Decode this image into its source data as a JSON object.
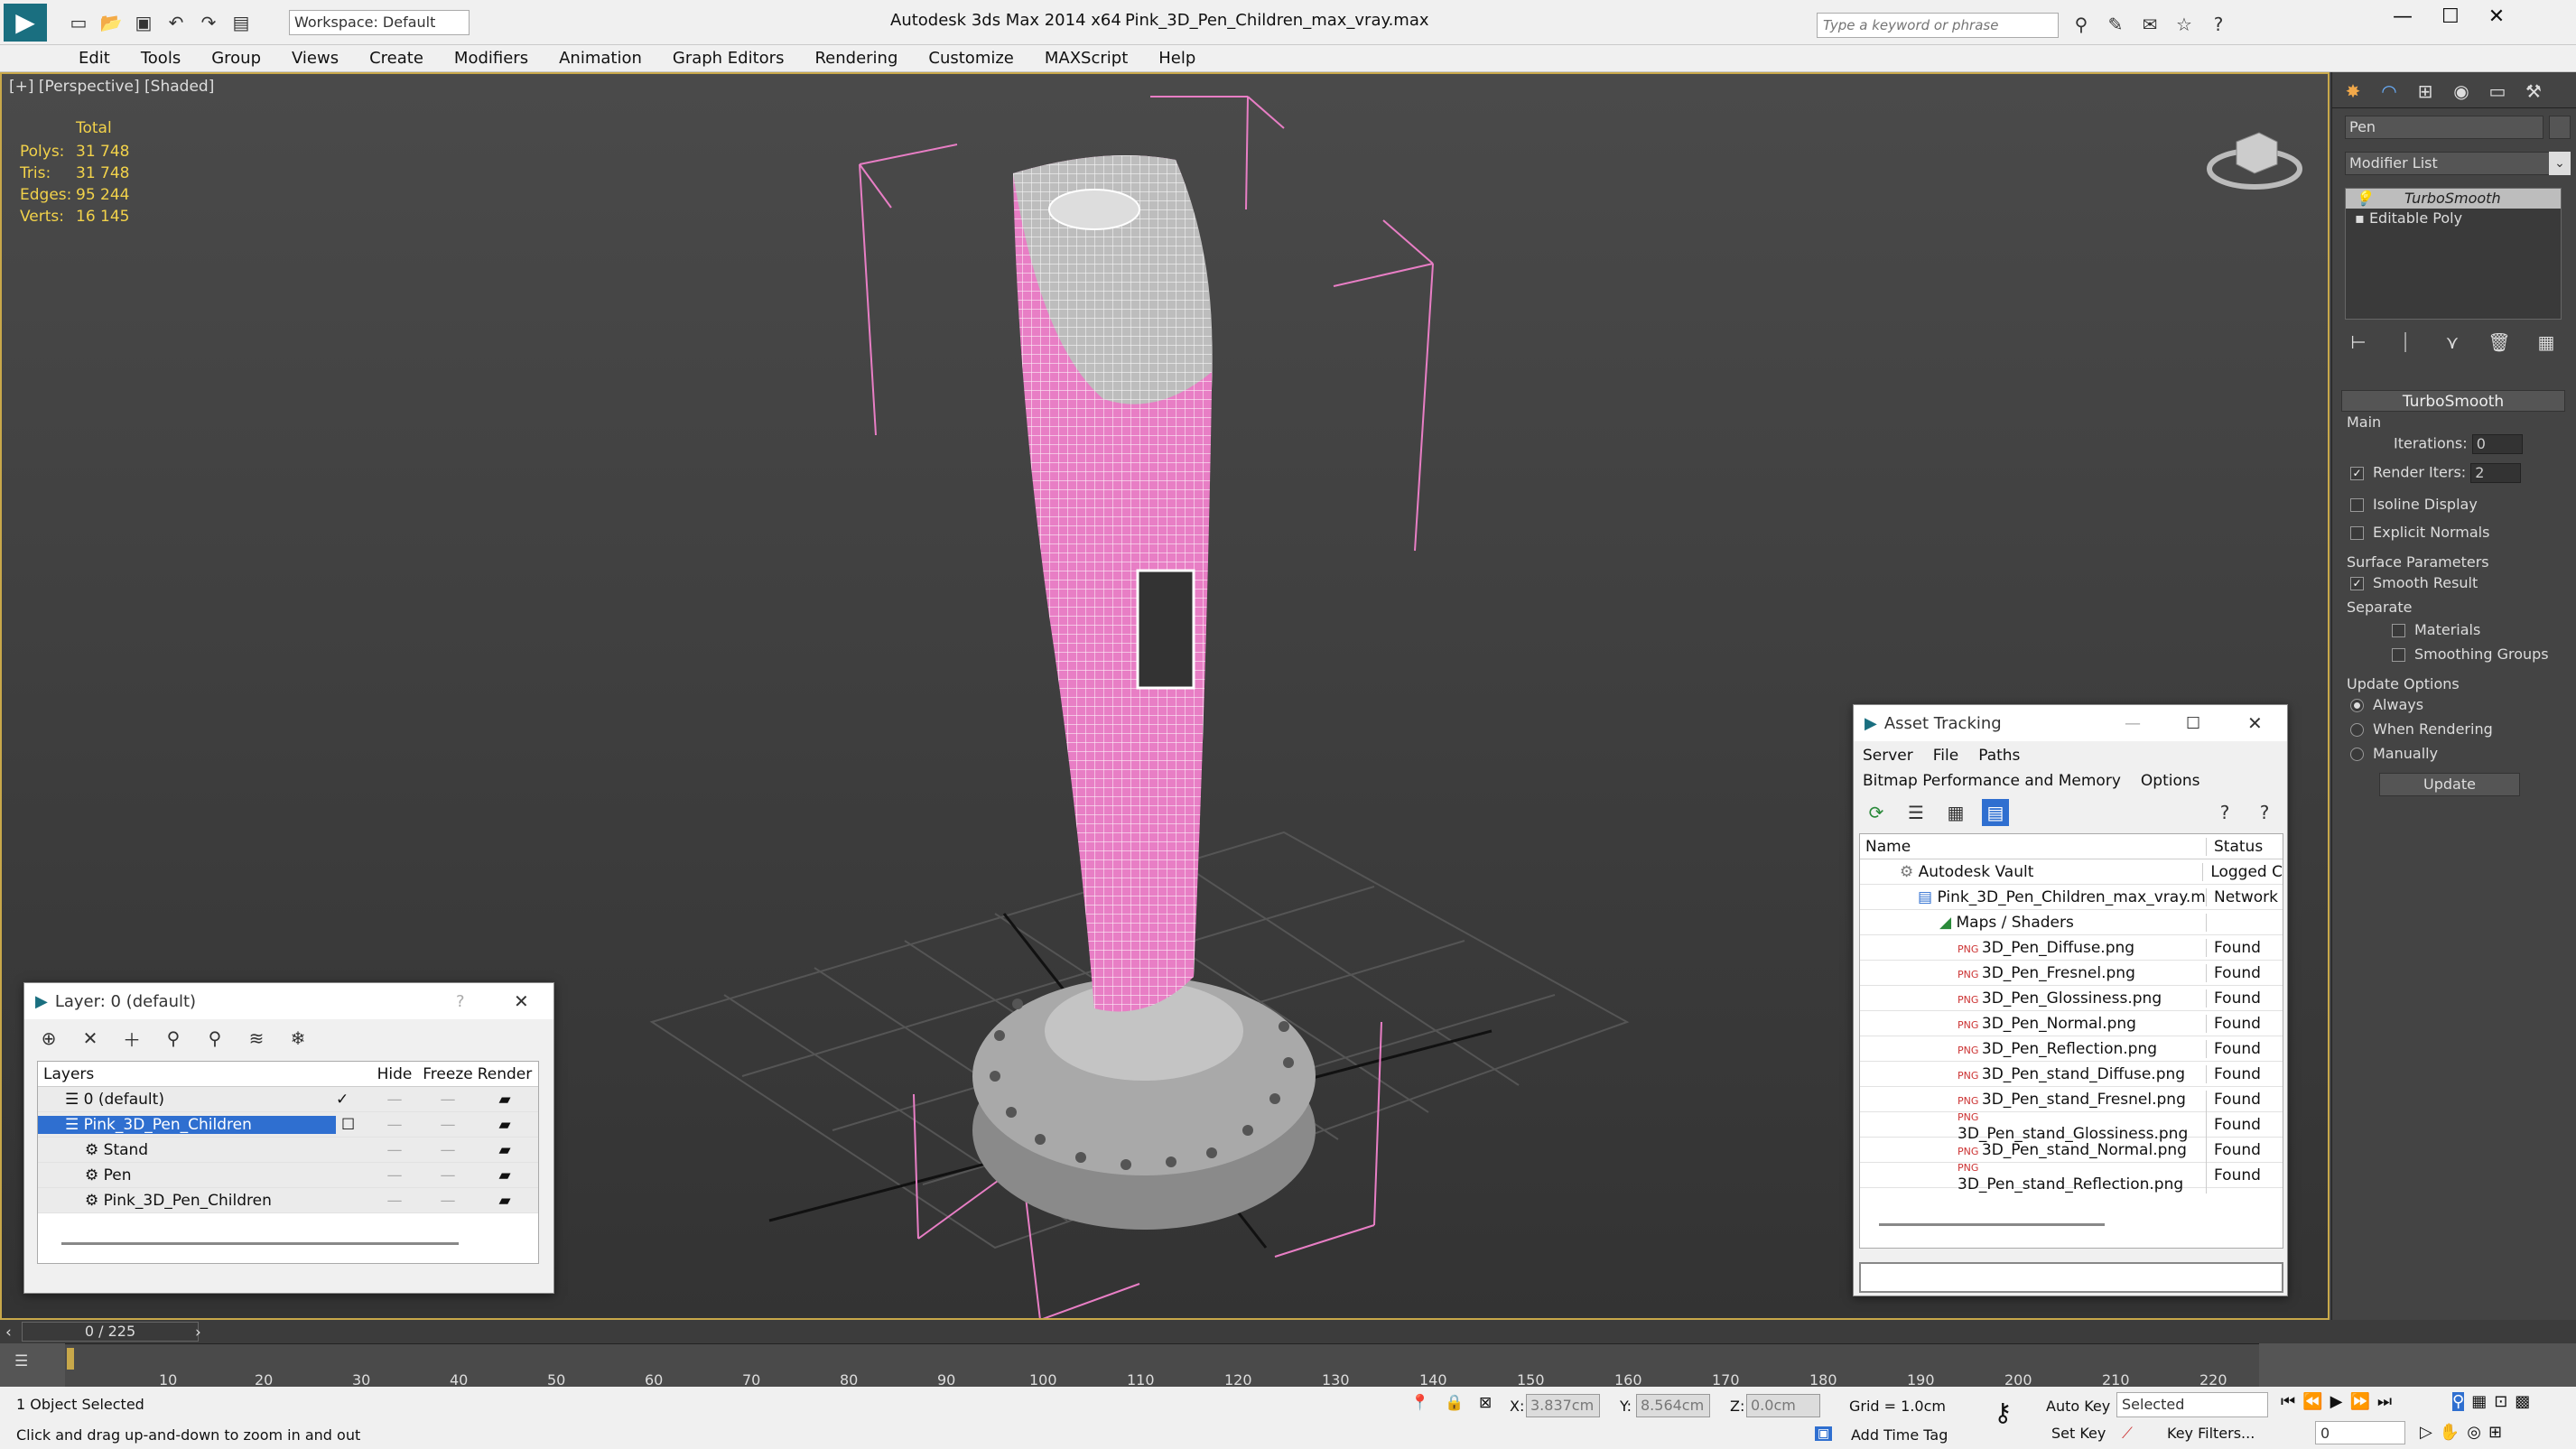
{
  "titlebar": {
    "workspace": "Workspace: Default",
    "app_title": "Autodesk 3ds Max  2014 x64",
    "file_title": "Pink_3D_Pen_Children_max_vray.max",
    "search_placeholder": "Type a keyword or phrase"
  },
  "menu": [
    "Edit",
    "Tools",
    "Group",
    "Views",
    "Create",
    "Modifiers",
    "Animation",
    "Graph Editors",
    "Rendering",
    "Customize",
    "MAXScript",
    "Help"
  ],
  "viewport": {
    "label": "[+] [Perspective] [Shaded]",
    "stats_header": "Total",
    "stats": [
      {
        "label": "Polys:",
        "value": "31 748"
      },
      {
        "label": "Tris:",
        "value": "31 748"
      },
      {
        "label": "Edges:",
        "value": "95 244"
      },
      {
        "label": "Verts:",
        "value": "16 145"
      }
    ]
  },
  "command_panel": {
    "object_name": "Pen",
    "modifier_list": "Modifier List",
    "stack": [
      "TurboSmooth",
      "Editable Poly"
    ],
    "rollout_title": "TurboSmooth",
    "main_label": "Main",
    "iterations_label": "Iterations:",
    "iterations_value": "0",
    "render_iters_label": "Render Iters:",
    "render_iters_value": "2",
    "isoline": "Isoline Display",
    "explicit": "Explicit Normals",
    "surface_params": "Surface Parameters",
    "smooth_result": "Smooth Result",
    "separate": "Separate",
    "materials": "Materials",
    "smoothing_groups": "Smoothing Groups",
    "update_options": "Update Options",
    "always": "Always",
    "when_rendering": "When Rendering",
    "manually": "Manually",
    "update_btn": "Update"
  },
  "layer_dialog": {
    "title": "Layer: 0 (default)",
    "help": "?",
    "columns": [
      "Layers",
      "Hide",
      "Freeze",
      "Render"
    ],
    "rows": [
      {
        "name": "0 (default)",
        "indent": 1
      },
      {
        "name": "Pink_3D_Pen_Children",
        "indent": 1
      },
      {
        "name": "Stand",
        "indent": 2
      },
      {
        "name": "Pen",
        "indent": 2
      },
      {
        "name": "Pink_3D_Pen_Children",
        "indent": 2
      }
    ]
  },
  "asset_dialog": {
    "title": "Asset Tracking",
    "menu1": [
      "Server",
      "File",
      "Paths"
    ],
    "menu2": [
      "Bitmap Performance and Memory",
      "Options"
    ],
    "columns": [
      "Name",
      "Status"
    ],
    "rows": [
      {
        "name": "Autodesk Vault",
        "status": "Logged C",
        "level": 1
      },
      {
        "name": "Pink_3D_Pen_Children_max_vray.max",
        "status": "Network",
        "level": 2
      },
      {
        "name": "Maps / Shaders",
        "status": "",
        "level": 3
      },
      {
        "name": "3D_Pen_Diffuse.png",
        "status": "Found",
        "level": 4
      },
      {
        "name": "3D_Pen_Fresnel.png",
        "status": "Found",
        "level": 4
      },
      {
        "name": "3D_Pen_Glossiness.png",
        "status": "Found",
        "level": 4
      },
      {
        "name": "3D_Pen_Normal.png",
        "status": "Found",
        "level": 4
      },
      {
        "name": "3D_Pen_Reflection.png",
        "status": "Found",
        "level": 4
      },
      {
        "name": "3D_Pen_stand_Diffuse.png",
        "status": "Found",
        "level": 4
      },
      {
        "name": "3D_Pen_stand_Fresnel.png",
        "status": "Found",
        "level": 4
      },
      {
        "name": "3D_Pen_stand_Glossiness.png",
        "status": "Found",
        "level": 4
      },
      {
        "name": "3D_Pen_stand_Normal.png",
        "status": "Found",
        "level": 4
      },
      {
        "name": "3D_Pen_stand_Reflection.png",
        "status": "Found",
        "level": 4
      }
    ]
  },
  "timeline": {
    "frame": "0 / 225",
    "ticks": [
      "10",
      "20",
      "30",
      "40",
      "50",
      "60",
      "70",
      "80",
      "90",
      "100",
      "110",
      "120",
      "130",
      "140",
      "150",
      "160",
      "170",
      "180",
      "190",
      "200",
      "210",
      "220"
    ]
  },
  "status": {
    "selected": "1 Object Selected",
    "prompt": "Click and drag up-and-down to zoom in and out",
    "x_label": "X:",
    "x_value": "3.837cm",
    "y_label": "Y:",
    "y_value": "8.564cm",
    "z_label": "Z:",
    "z_value": "0.0cm",
    "grid": "Grid = 1.0cm",
    "add_time_tag": "Add Time Tag",
    "auto_key": "Auto Key",
    "set_key": "Set Key",
    "selected_dropdown": "Selected",
    "key_filters": "Key Filters...",
    "frame_value": "0"
  },
  "colors": {
    "accent": "#2f6fd0",
    "viewport_border": "#c8a84a",
    "stats": "#f2d24a",
    "pink": "#e87ec5"
  }
}
